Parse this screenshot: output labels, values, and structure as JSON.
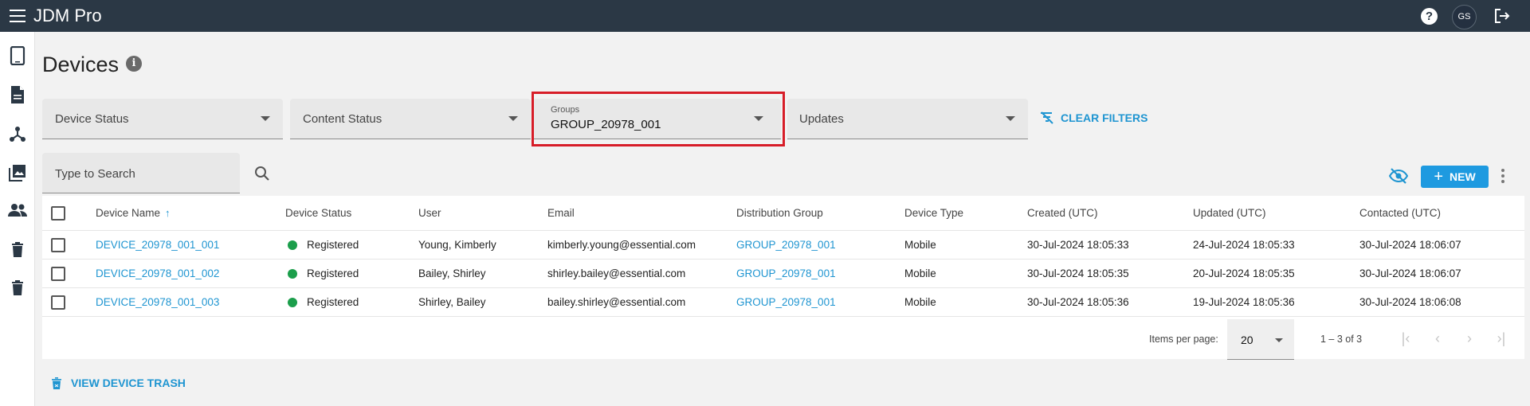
{
  "app": {
    "title": "JDM Pro",
    "user_initials": "GS"
  },
  "icons": {
    "menu": "menu-icon",
    "help": "help-icon",
    "logout": "logout-icon"
  },
  "sidebar": {
    "items": [
      {
        "name": "devices",
        "icon": "tablet-icon"
      },
      {
        "name": "content",
        "icon": "document-icon"
      },
      {
        "name": "groups",
        "icon": "hub-icon"
      },
      {
        "name": "media",
        "icon": "images-icon"
      },
      {
        "name": "users",
        "icon": "people-icon"
      },
      {
        "name": "trash",
        "icon": "trash-icon"
      },
      {
        "name": "trash-2",
        "icon": "trash-icon"
      }
    ]
  },
  "page": {
    "title": "Devices",
    "info_glyph": "i"
  },
  "filters": {
    "device_status": "Device Status",
    "content_status": "Content Status",
    "groups_label": "Groups",
    "groups_value": "GROUP_20978_001",
    "updates": "Updates",
    "clear": "CLEAR FILTERS"
  },
  "search": {
    "placeholder": "Type to Search"
  },
  "toolbar": {
    "new_label": "NEW"
  },
  "table": {
    "headers": {
      "device_name": "Device Name",
      "device_status": "Device Status",
      "user": "User",
      "email": "Email",
      "distribution_group": "Distribution Group",
      "device_type": "Device Type",
      "created": "Created (UTC)",
      "updated": "Updated (UTC)",
      "contacted": "Contacted (UTC)"
    },
    "sort_glyph": "↑",
    "rows": [
      {
        "name": "DEVICE_20978_001_001",
        "status": "Registered",
        "user": "Young, Kimberly",
        "email": "kimberly.young@essential.com",
        "group": "GROUP_20978_001",
        "type": "Mobile",
        "created": "30-Jul-2024 18:05:33",
        "updated": "24-Jul-2024 18:05:33",
        "contacted": "30-Jul-2024 18:06:07"
      },
      {
        "name": "DEVICE_20978_001_002",
        "status": "Registered",
        "user": "Bailey, Shirley",
        "email": "shirley.bailey@essential.com",
        "group": "GROUP_20978_001",
        "type": "Mobile",
        "created": "30-Jul-2024 18:05:35",
        "updated": "20-Jul-2024 18:05:35",
        "contacted": "30-Jul-2024 18:06:07"
      },
      {
        "name": "DEVICE_20978_001_003",
        "status": "Registered",
        "user": "Shirley, Bailey",
        "email": "bailey.shirley@essential.com",
        "group": "GROUP_20978_001",
        "type": "Mobile",
        "created": "30-Jul-2024 18:05:36",
        "updated": "19-Jul-2024 18:05:36",
        "contacted": "30-Jul-2024 18:06:08"
      }
    ]
  },
  "pagination": {
    "items_per_page_label": "Items per page:",
    "page_size": "20",
    "range": "1 – 3 of 3",
    "first_glyph": "|‹",
    "prev_glyph": "‹",
    "next_glyph": "›",
    "last_glyph": "›|"
  },
  "footer": {
    "view_trash": "VIEW DEVICE TRASH"
  },
  "colors": {
    "accent": "#1f95d1",
    "topbar": "#2b3845",
    "highlight": "#d71d28",
    "status_registered": "#1b9e4b"
  }
}
